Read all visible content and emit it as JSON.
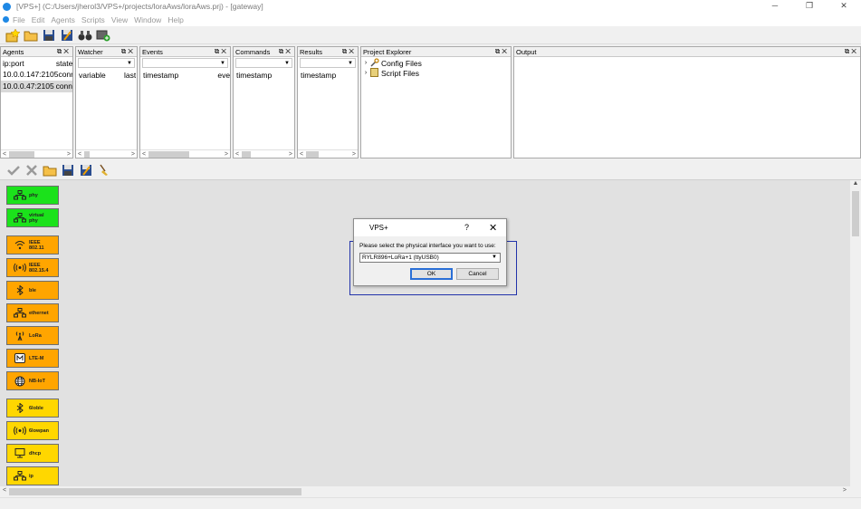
{
  "window": {
    "title": "[VPS+] (C:/Users/jherol3/VPS+/projects/loraAws/loraAws.prj) - [gateway]",
    "controls": [
      "─",
      "❐",
      "✕"
    ]
  },
  "menu": [
    "File",
    "Edit",
    "Agents",
    "Scripts",
    "View",
    "Window",
    "Help"
  ],
  "panels": {
    "agents": {
      "title": "Agents",
      "col1": "ip:port",
      "col2": "state",
      "rows": [
        {
          "ip": "10.0.0.147:2105",
          "state": "conn"
        },
        {
          "ip": "10.0.0.47:2105",
          "state": "conn"
        }
      ]
    },
    "watcher": {
      "title": "Watcher",
      "col1": "variable",
      "col2": "last"
    },
    "events": {
      "title": "Events",
      "col1": "timestamp",
      "col2": "eve"
    },
    "commands": {
      "title": "Commands",
      "col1": "timestamp"
    },
    "results": {
      "title": "Results",
      "col1": "timestamp"
    },
    "project": {
      "title": "Project Explorer",
      "items": [
        "Config Files",
        "Script Files"
      ]
    },
    "output": {
      "title": "Output"
    }
  },
  "nodes": [
    {
      "label": "phy",
      "color": "#1be21b",
      "icon": "network-icon"
    },
    {
      "label": "virtual phy",
      "color": "#1be21b",
      "icon": "network-icon"
    },
    {
      "label": "IEEE 802.11",
      "color": "#ffa500",
      "icon": "wifi-icon"
    },
    {
      "label": "IEEE 802.15.4",
      "color": "#ffa500",
      "icon": "radio-wave-icon"
    },
    {
      "label": "ble",
      "color": "#ffa500",
      "icon": "bluetooth-icon"
    },
    {
      "label": "ethernet",
      "color": "#ffa500",
      "icon": "network-icon"
    },
    {
      "label": "LoRa",
      "color": "#ffa500",
      "icon": "antenna-icon"
    },
    {
      "label": "LTE-M",
      "color": "#ffa500",
      "icon": "lte-icon"
    },
    {
      "label": "NB-IoT",
      "color": "#ffa500",
      "icon": "globe-icon"
    },
    {
      "label": "6loble",
      "color": "#ffd700",
      "icon": "bluetooth-icon"
    },
    {
      "label": "6lowpan",
      "color": "#ffd700",
      "icon": "radio-wave-icon"
    },
    {
      "label": "dhcp",
      "color": "#ffd700",
      "icon": "monitor-icon"
    },
    {
      "label": "ip",
      "color": "#ffd700",
      "icon": "network-icon"
    }
  ],
  "dialog": {
    "title": "VPS+",
    "help": "?",
    "close": "✕",
    "prompt": "Please select the physical interface you want to use:",
    "selected": "RYLR896+LoRa+1 (ttyUSB0)",
    "ok": "OK",
    "cancel": "Cancel"
  }
}
